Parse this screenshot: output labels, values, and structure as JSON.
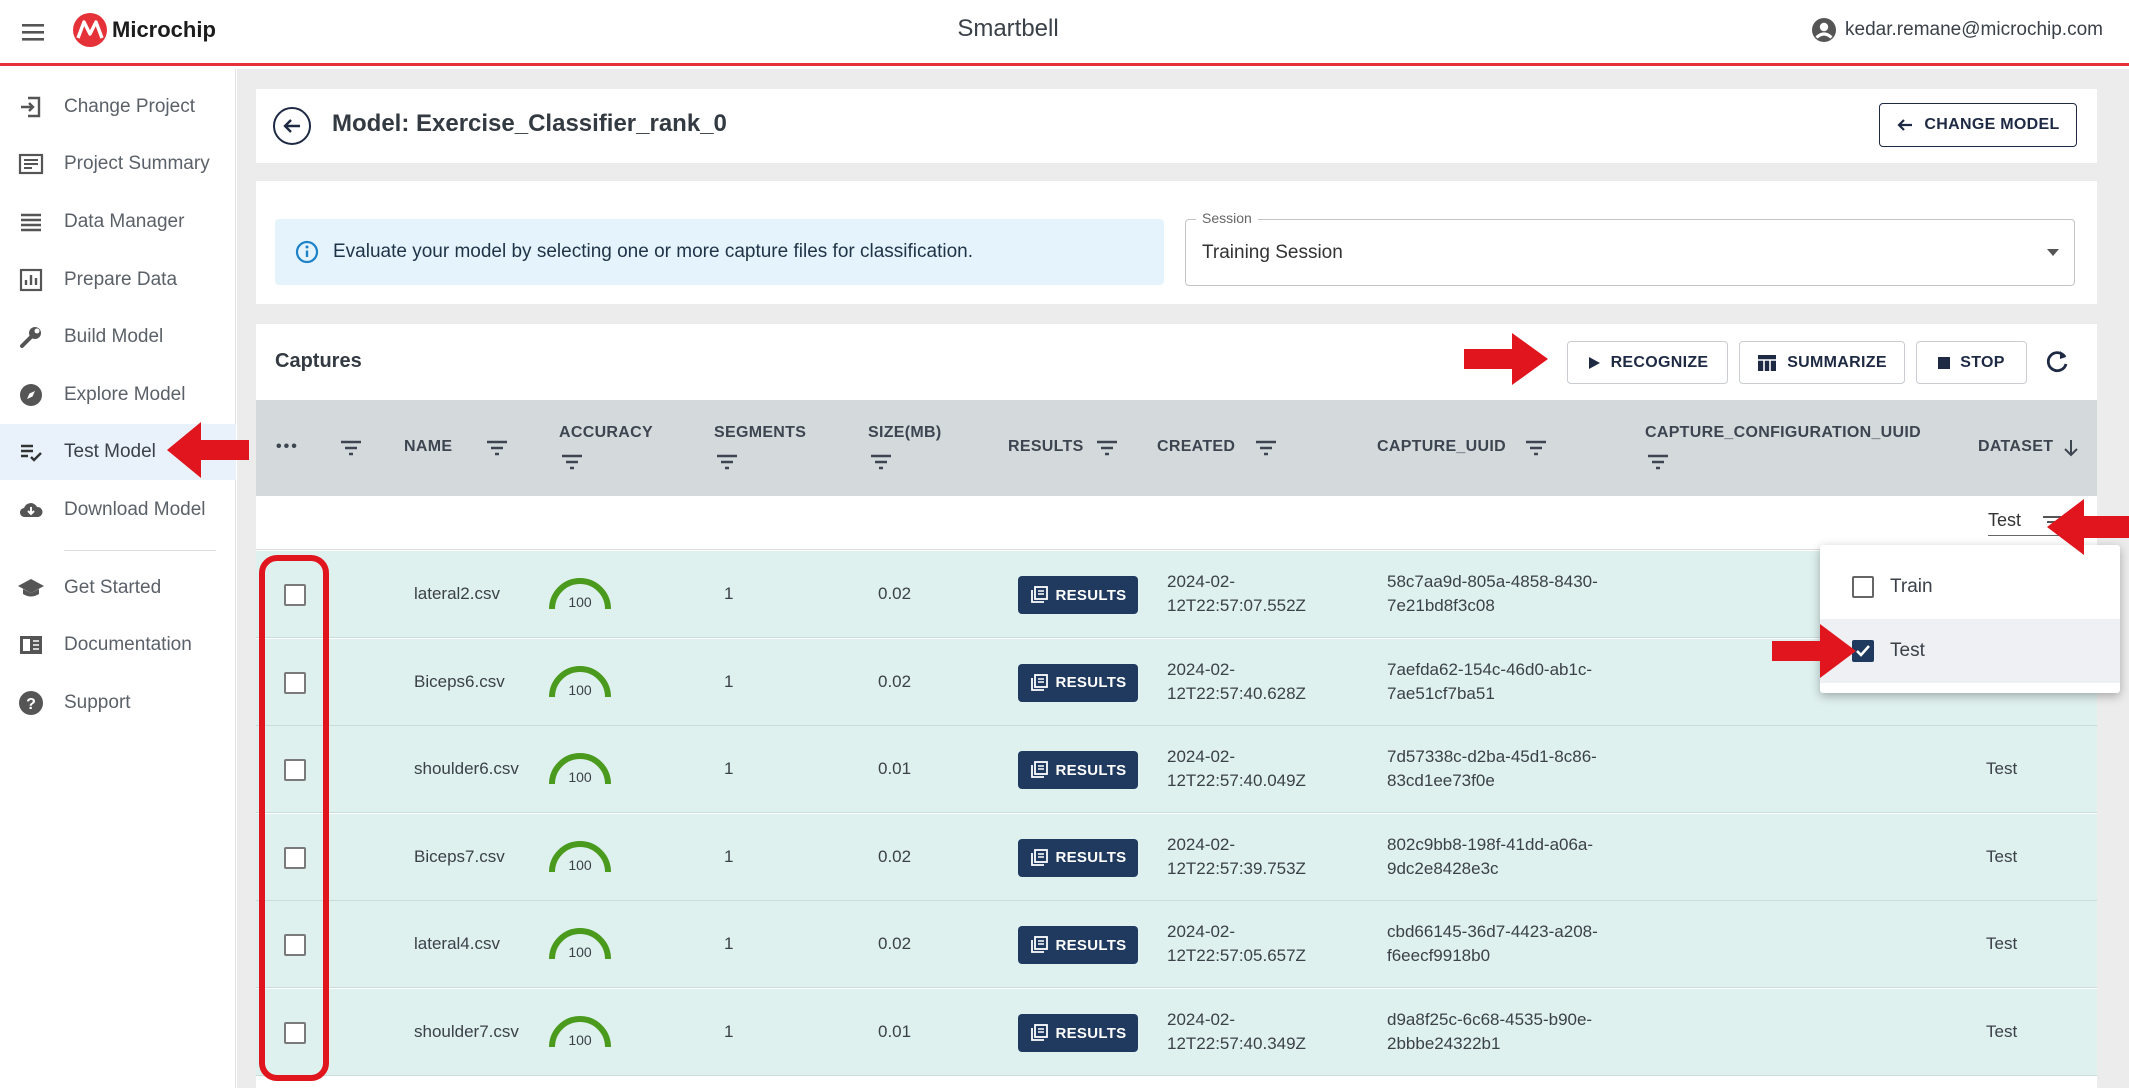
{
  "topbar": {
    "app_title": "Smartbell",
    "logo_text": "Microchip",
    "user_email": "kedar.remane@microchip.com"
  },
  "sidebar": {
    "items": [
      {
        "label": "Change Project",
        "icon": "login-icon"
      },
      {
        "label": "Project Summary",
        "icon": "summary-icon"
      },
      {
        "label": "Data Manager",
        "icon": "list-icon"
      },
      {
        "label": "Prepare Data",
        "icon": "chart-icon"
      },
      {
        "label": "Build Model",
        "icon": "wrench-icon"
      },
      {
        "label": "Explore Model",
        "icon": "compass-icon"
      },
      {
        "label": "Test Model",
        "icon": "checklist-icon",
        "active": true
      },
      {
        "label": "Download Model",
        "icon": "cloud-download-icon"
      },
      {
        "label": "Get Started",
        "icon": "school-icon"
      },
      {
        "label": "Documentation",
        "icon": "book-icon"
      },
      {
        "label": "Support",
        "icon": "help-icon"
      }
    ]
  },
  "model": {
    "title": "Model: Exercise_Classifier_rank_0",
    "change_label": "CHANGE MODEL"
  },
  "session": {
    "info_text": "Evaluate your model by selecting one or more capture files for classification.",
    "label": "Session",
    "value": "Training Session"
  },
  "captures": {
    "title": "Captures",
    "recognize_label": "RECOGNIZE",
    "summarize_label": "SUMMARIZE",
    "stop_label": "STOP",
    "columns": {
      "more": "•••",
      "name": "NAME",
      "accuracy": "ACCURACY",
      "segments": "SEGMENTS",
      "size": "SIZE(MB)",
      "results": "RESULTS",
      "created": "CREATED",
      "capture_uuid": "CAPTURE_UUID",
      "config_uuid": "CAPTURE_CONFIGURATION_UUID",
      "dataset": "DATASET"
    },
    "dataset_filter": "Test",
    "results_button_label": "RESULTS",
    "rows": [
      {
        "name": "lateral2.csv",
        "accuracy": "100",
        "segments": "1",
        "size": "0.02",
        "created_1": "2024-02-",
        "created_2": "12T22:57:07.552Z",
        "uuid_1": "58c7aa9d-805a-4858-8430-",
        "uuid_2": "7e21bd8f3c08",
        "dataset": ""
      },
      {
        "name": "Biceps6.csv",
        "accuracy": "100",
        "segments": "1",
        "size": "0.02",
        "created_1": "2024-02-",
        "created_2": "12T22:57:40.628Z",
        "uuid_1": "7aefda62-154c-46d0-ab1c-",
        "uuid_2": "7ae51cf7ba51",
        "dataset": ""
      },
      {
        "name": "shoulder6.csv",
        "accuracy": "100",
        "segments": "1",
        "size": "0.01",
        "created_1": "2024-02-",
        "created_2": "12T22:57:40.049Z",
        "uuid_1": "7d57338c-d2ba-45d1-8c86-",
        "uuid_2": "83cd1ee73f0e",
        "dataset": "Test"
      },
      {
        "name": "Biceps7.csv",
        "accuracy": "100",
        "segments": "1",
        "size": "0.02",
        "created_1": "2024-02-",
        "created_2": "12T22:57:39.753Z",
        "uuid_1": "802c9bb8-198f-41dd-a06a-",
        "uuid_2": "9dc2e8428e3c",
        "dataset": "Test"
      },
      {
        "name": "lateral4.csv",
        "accuracy": "100",
        "segments": "1",
        "size": "0.02",
        "created_1": "2024-02-",
        "created_2": "12T22:57:05.657Z",
        "uuid_1": "cbd66145-36d7-4423-a208-",
        "uuid_2": "f6eecf9918b0",
        "dataset": "Test"
      },
      {
        "name": "shoulder7.csv",
        "accuracy": "100",
        "segments": "1",
        "size": "0.01",
        "created_1": "2024-02-",
        "created_2": "12T22:57:40.349Z",
        "uuid_1": "d9a8f25c-6c68-4535-b90e-",
        "uuid_2": "2bbbe24322b1",
        "dataset": "Test"
      }
    ]
  },
  "dataset_dropdown": {
    "options": [
      {
        "label": "Train",
        "checked": false
      },
      {
        "label": "Test",
        "checked": true
      }
    ]
  },
  "colors": {
    "accent_red": "#e53238",
    "navy": "#1f3a5e",
    "gauge_green": "#4a9a1e",
    "row_bg": "#dff1ef"
  }
}
